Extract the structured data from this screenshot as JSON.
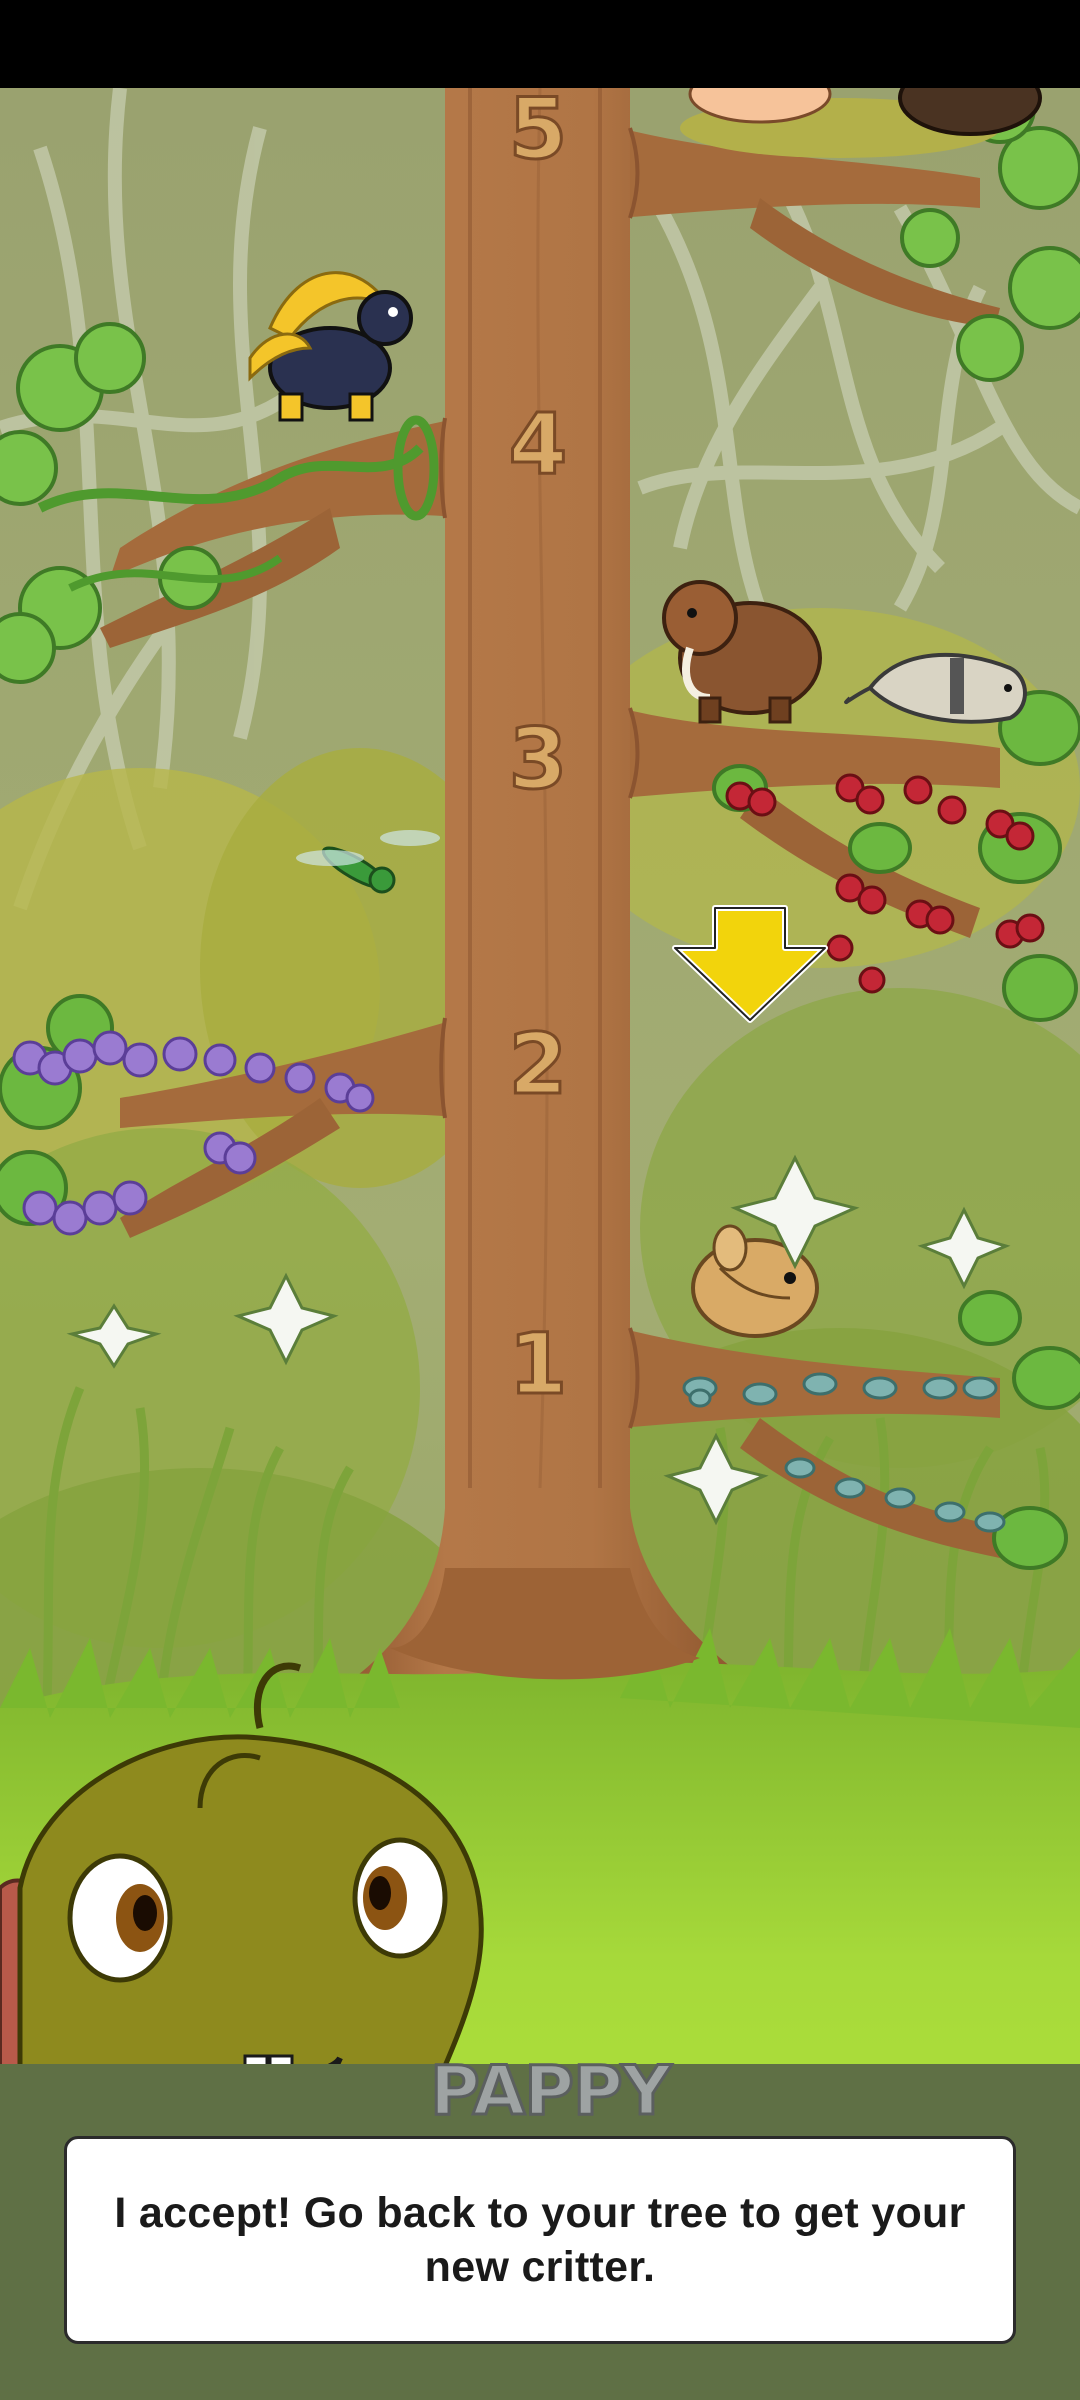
{
  "game": {
    "tree_levels": [
      "5",
      "4",
      "3",
      "2",
      "1"
    ],
    "critters": [
      {
        "name": "horned-critter"
      },
      {
        "name": "fluffy-creature"
      },
      {
        "name": "woolly-mammoth"
      },
      {
        "name": "ferret"
      },
      {
        "name": "dragonfly"
      },
      {
        "name": "hamster"
      }
    ],
    "indicator": {
      "icon": "arrow-down-icon",
      "color": "#f2d40c"
    },
    "dialog": {
      "speaker": "PAPPY",
      "text": "I accept! Go back to your tree to get your new critter."
    },
    "colors": {
      "trunk": "#a96e3f",
      "dialog_band": "#5f7045",
      "grass": "#a8d838",
      "forest_bg": "#9ca772"
    }
  }
}
